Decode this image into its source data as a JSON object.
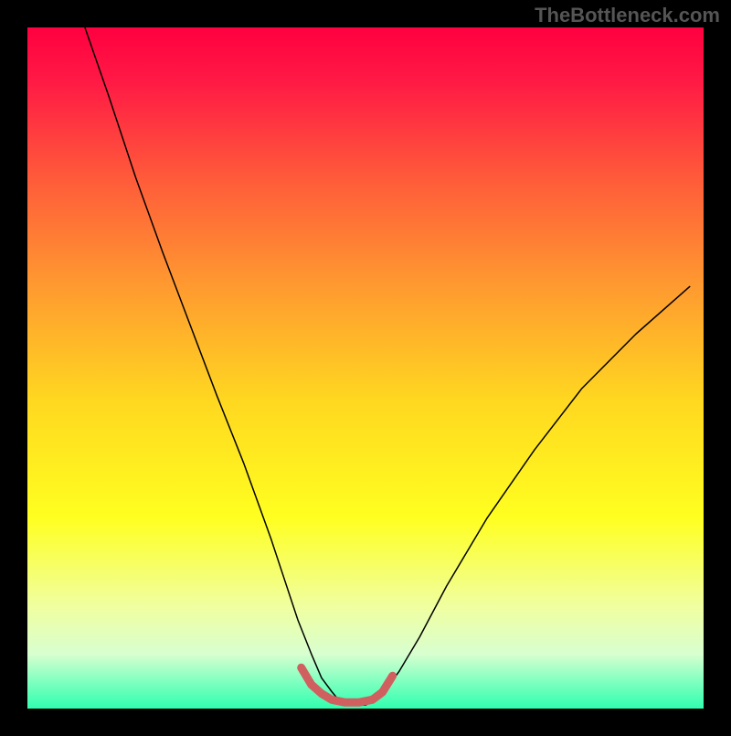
{
  "watermark": "TheBottleneck.com",
  "chart_data": {
    "type": "line",
    "title": "",
    "xlabel": "",
    "ylabel": "",
    "xlim": [
      0,
      100
    ],
    "ylim": [
      0,
      100
    ],
    "background_gradient": {
      "stops": [
        {
          "offset": 0.0,
          "color": "#ff0040"
        },
        {
          "offset": 0.08,
          "color": "#ff1a45"
        },
        {
          "offset": 0.22,
          "color": "#ff5a3a"
        },
        {
          "offset": 0.38,
          "color": "#ff9a30"
        },
        {
          "offset": 0.55,
          "color": "#ffd820"
        },
        {
          "offset": 0.72,
          "color": "#ffff20"
        },
        {
          "offset": 0.85,
          "color": "#f0ffa0"
        },
        {
          "offset": 0.92,
          "color": "#d8ffd0"
        },
        {
          "offset": 0.96,
          "color": "#80ffc0"
        },
        {
          "offset": 1.0,
          "color": "#30ffb0"
        }
      ]
    },
    "series": [
      {
        "name": "bottleneck-curve",
        "color": "#000000",
        "width": 1.5,
        "x": [
          8.5,
          12,
          16,
          20,
          24,
          28,
          32,
          36,
          38,
          40,
          42,
          43.5,
          45,
          46,
          48,
          50,
          51.5,
          53,
          55,
          58,
          62,
          68,
          75,
          82,
          90,
          98
        ],
        "y": [
          100,
          90,
          78,
          67,
          56.5,
          46,
          36,
          25,
          19,
          13,
          8,
          4.5,
          2.5,
          1.3,
          0.5,
          0.5,
          1.3,
          2.8,
          5.5,
          10.5,
          18,
          28,
          38,
          47,
          55,
          62
        ]
      },
      {
        "name": "optimal-range-marker",
        "color": "#d06060",
        "width": 9,
        "linecap": "round",
        "x": [
          40.5,
          42,
          43.5,
          45,
          47,
          49,
          51,
          52.5,
          54
        ],
        "y": [
          6,
          3.5,
          2.2,
          1.3,
          0.9,
          0.9,
          1.3,
          2.4,
          4.8
        ]
      }
    ]
  }
}
